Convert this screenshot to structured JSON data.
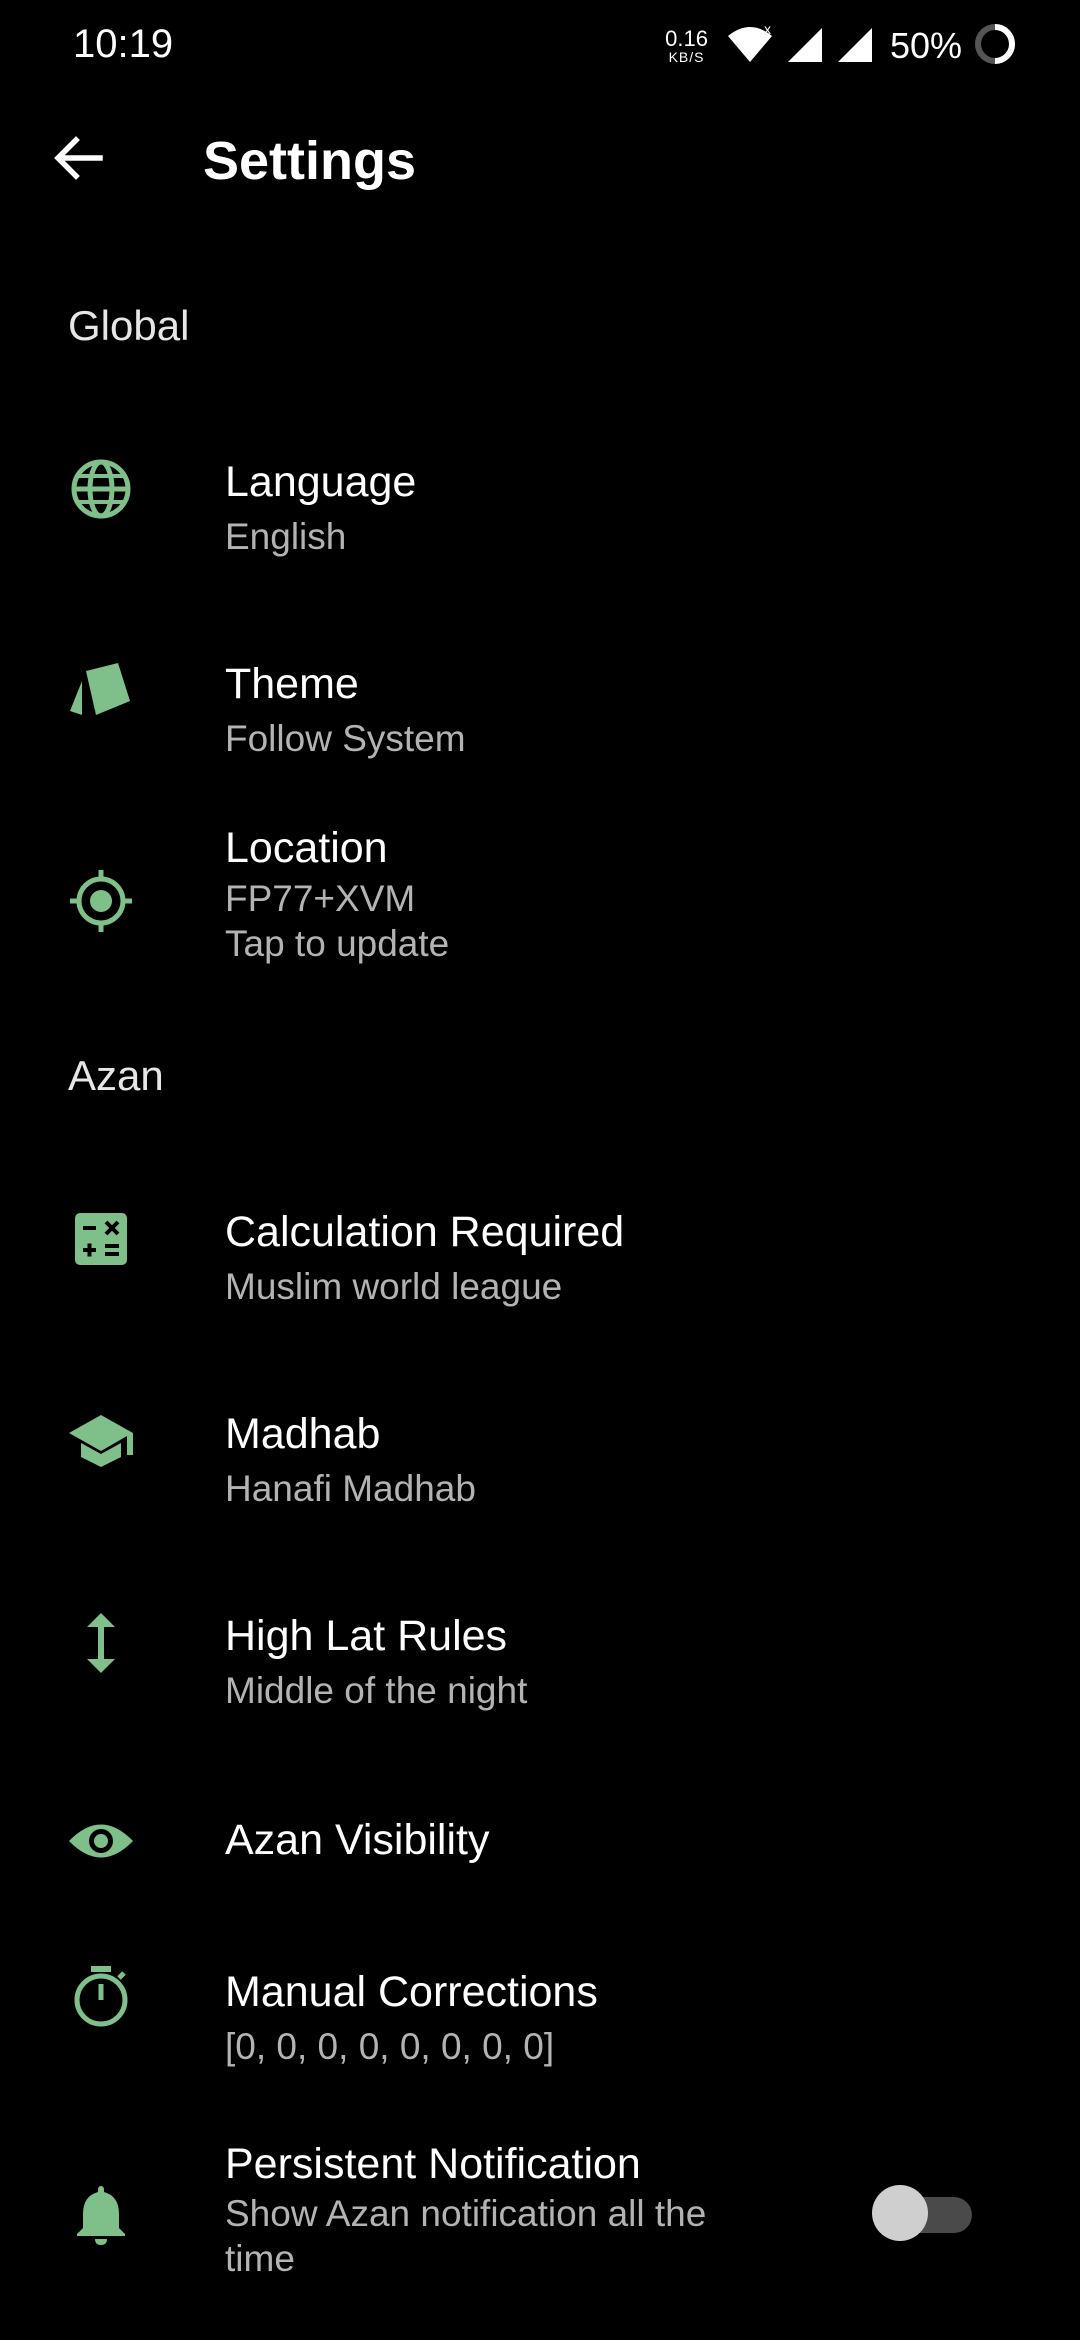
{
  "status_bar": {
    "time": "10:19",
    "net_speed_value": "0.16",
    "net_speed_unit": "KB/S",
    "battery": "50%"
  },
  "header": {
    "title": "Settings",
    "back_icon": "arrow-back-icon"
  },
  "colors": {
    "accent": "#7fbf8a",
    "background": "#000000",
    "primary_text": "#ffffff",
    "secondary_text": "#b3b3b3"
  },
  "sections": {
    "global": {
      "title": "Global",
      "items": [
        {
          "title": "Language",
          "subtitle": "English",
          "icon": "globe-icon"
        },
        {
          "title": "Theme",
          "subtitle": "Follow System",
          "icon": "cards-icon"
        },
        {
          "title": "Location",
          "subtitle": "FP77+XVM",
          "subtitle2": "Tap to update",
          "icon": "gps-target-icon"
        }
      ]
    },
    "azan": {
      "title": "Azan",
      "items": [
        {
          "title": "Calculation Required",
          "subtitle": "Muslim world league",
          "icon": "calculator-icon"
        },
        {
          "title": "Madhab",
          "subtitle": "Hanafi Madhab",
          "icon": "graduation-cap-icon"
        },
        {
          "title": "High Lat Rules",
          "subtitle": "Middle of the night",
          "icon": "vertical-arrows-icon"
        },
        {
          "title": "Azan Visibility",
          "icon": "eye-icon"
        },
        {
          "title": "Manual Corrections",
          "subtitle": "[0, 0, 0, 0, 0, 0, 0, 0]",
          "icon": "timer-icon"
        },
        {
          "title": "Persistent Notification",
          "subtitle": "Show Azan notification all the",
          "subtitle2": "time",
          "icon": "bell-icon",
          "toggle_on": false
        }
      ]
    }
  }
}
